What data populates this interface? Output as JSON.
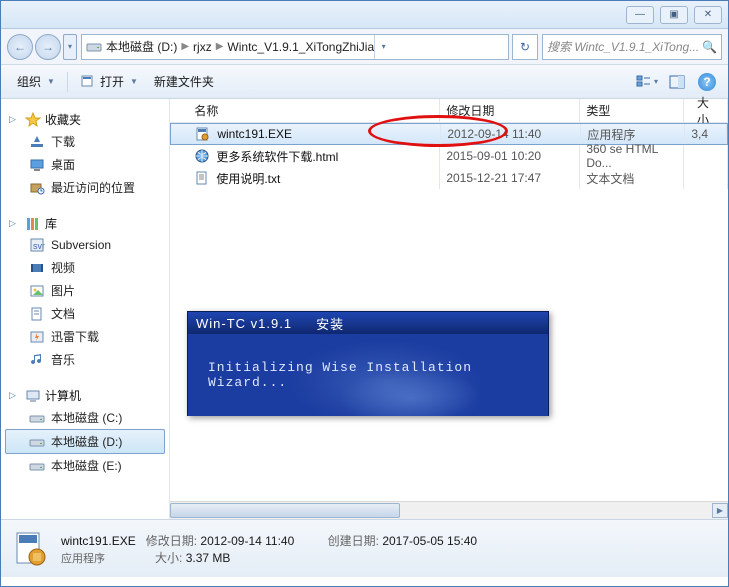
{
  "titlebar": {
    "min": "—",
    "max": "▣",
    "close": "✕"
  },
  "nav": {
    "back": "←",
    "fwd": "→",
    "dd": "▾"
  },
  "breadcrumb": {
    "items": [
      "本地磁盘 (D:)",
      "rjxz",
      "Wintc_V1.9.1_XiTongZhiJia"
    ],
    "refresh": "↻"
  },
  "search": {
    "placeholder": "搜索 Wintc_V1.9.1_XiTong...",
    "icon": "🔍"
  },
  "toolbar": {
    "organize": "组织",
    "open": "打开",
    "newfolder": "新建文件夹",
    "view_dd": "▾",
    "help": "?"
  },
  "sidebar": {
    "fav": {
      "label": "收藏夹",
      "items": [
        "下载",
        "桌面",
        "最近访问的位置"
      ]
    },
    "lib": {
      "label": "库",
      "items": [
        "Subversion",
        "视频",
        "图片",
        "文档",
        "迅雷下载",
        "音乐"
      ]
    },
    "comp": {
      "label": "计算机",
      "items": [
        "本地磁盘 (C:)",
        "本地磁盘 (D:)",
        "本地磁盘 (E:)"
      ],
      "selected_index": 1
    }
  },
  "columns": {
    "name": "名称",
    "date": "修改日期",
    "type": "类型",
    "size": "大小"
  },
  "files": [
    {
      "name": "wintc191.EXE",
      "date": "2012-09-14 11:40",
      "type": "应用程序",
      "size": "3,4",
      "selected": true
    },
    {
      "name": "更多系统软件下载.html",
      "date": "2015-09-01 10:20",
      "type": "360 se HTML Do...",
      "size": ""
    },
    {
      "name": "使用说明.txt",
      "date": "2015-12-21 17:47",
      "type": "文本文档",
      "size": ""
    }
  ],
  "details": {
    "title": "wintc191.EXE",
    "subtitle": "应用程序",
    "mod_label": "修改日期:",
    "mod_val": "2012-09-14 11:40",
    "size_label": "大小:",
    "size_val": "3.37 MB",
    "create_label": "创建日期:",
    "create_val": "2017-05-05 15:40"
  },
  "installer": {
    "t1": "Win-TC v1.9.1",
    "t2": "安装",
    "msg": "Initializing Wise Installation Wizard..."
  }
}
